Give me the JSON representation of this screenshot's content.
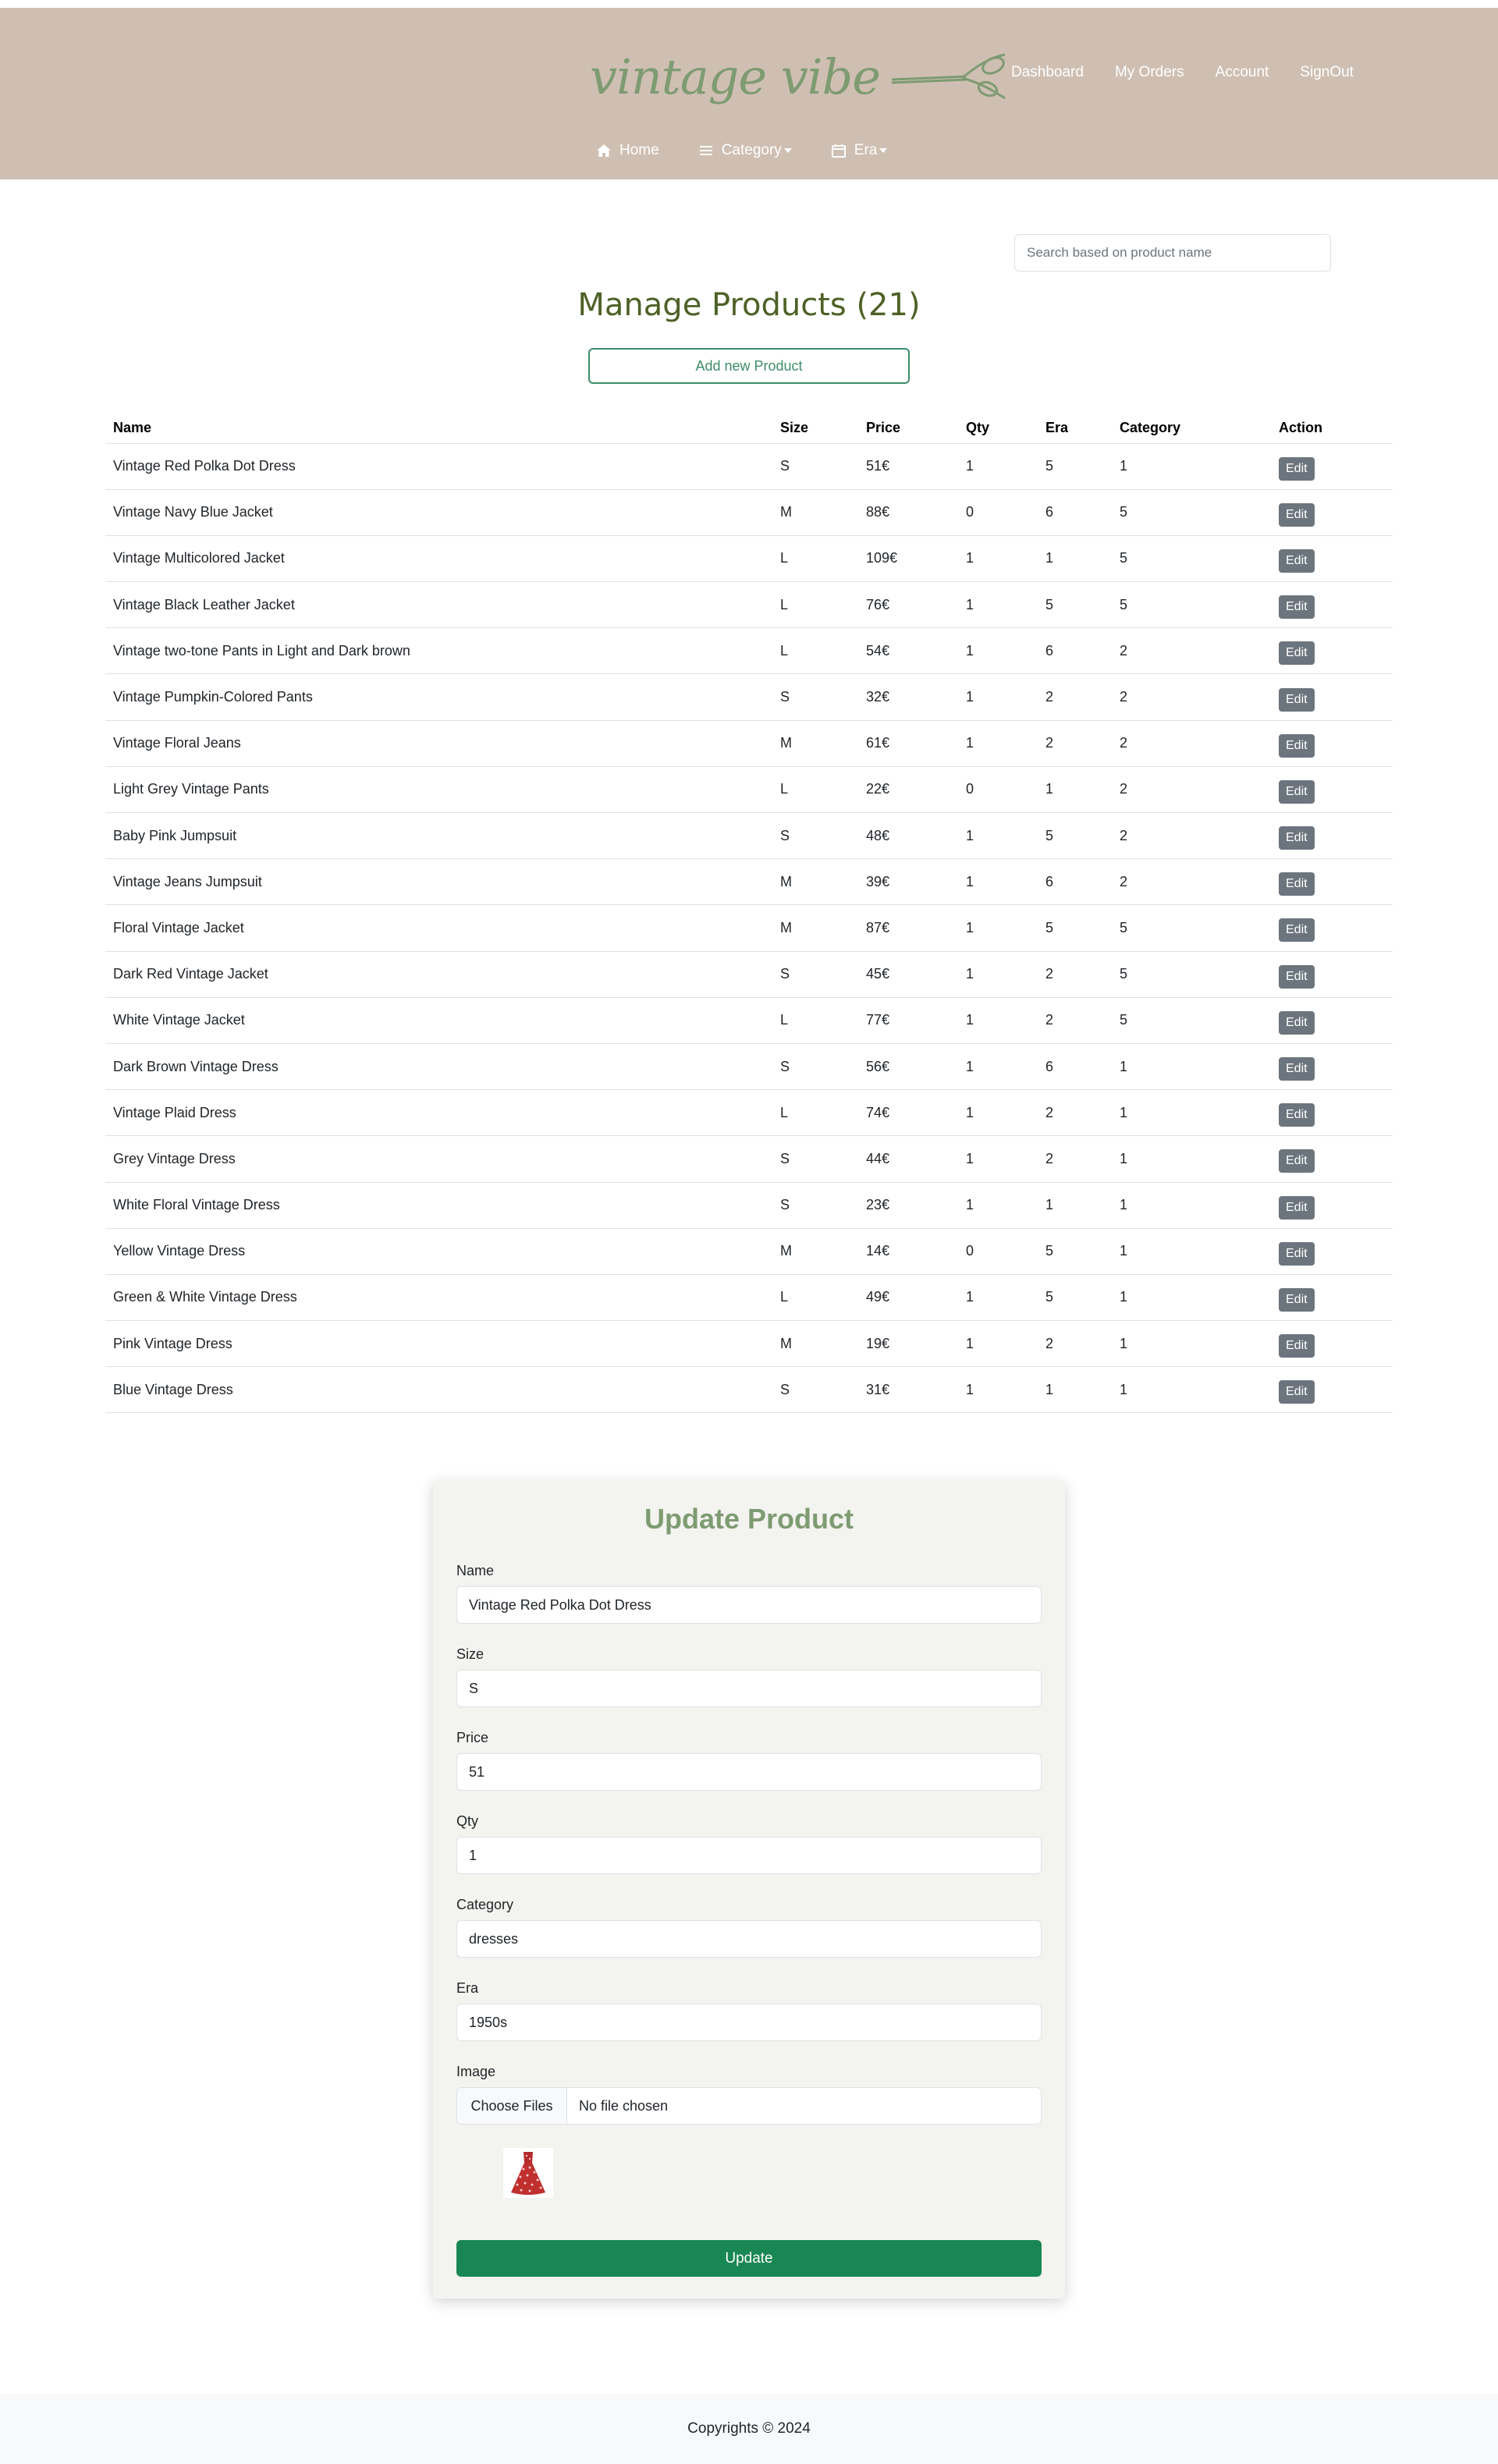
{
  "brand": {
    "name": "vintage vibe",
    "accent": "#7e9b72"
  },
  "top_links": [
    "Dashboard",
    "My Orders",
    "Account",
    "SignOut"
  ],
  "nav": {
    "home": "Home",
    "category": "Category",
    "era": "Era"
  },
  "search": {
    "placeholder": "Search based on product name"
  },
  "page": {
    "title": "Manage Products (21)",
    "add_button": "Add new Product"
  },
  "table": {
    "headers": [
      "Name",
      "Size",
      "Price",
      "Qty",
      "Era",
      "Category",
      "Action"
    ],
    "edit_label": "Edit",
    "rows": [
      [
        "Vintage Red Polka Dot Dress",
        "S",
        "51€",
        "1",
        "5",
        "1"
      ],
      [
        "Vintage Navy Blue Jacket",
        "M",
        "88€",
        "0",
        "6",
        "5"
      ],
      [
        "Vintage Multicolored Jacket",
        "L",
        "109€",
        "1",
        "1",
        "5"
      ],
      [
        "Vintage Black Leather Jacket",
        "L",
        "76€",
        "1",
        "5",
        "5"
      ],
      [
        "Vintage two-tone Pants in Light and Dark brown",
        "L",
        "54€",
        "1",
        "6",
        "2"
      ],
      [
        "Vintage Pumpkin-Colored Pants",
        "S",
        "32€",
        "1",
        "2",
        "2"
      ],
      [
        "Vintage Floral Jeans",
        "M",
        "61€",
        "1",
        "2",
        "2"
      ],
      [
        "Light Grey Vintage Pants",
        "L",
        "22€",
        "0",
        "1",
        "2"
      ],
      [
        "Baby Pink Jumpsuit",
        "S",
        "48€",
        "1",
        "5",
        "2"
      ],
      [
        "Vintage Jeans Jumpsuit",
        "M",
        "39€",
        "1",
        "6",
        "2"
      ],
      [
        "Floral Vintage Jacket",
        "M",
        "87€",
        "1",
        "5",
        "5"
      ],
      [
        "Dark Red Vintage Jacket",
        "S",
        "45€",
        "1",
        "2",
        "5"
      ],
      [
        "White Vintage Jacket",
        "L",
        "77€",
        "1",
        "2",
        "5"
      ],
      [
        "Dark Brown Vintage Dress",
        "S",
        "56€",
        "1",
        "6",
        "1"
      ],
      [
        "Vintage Plaid Dress",
        "L",
        "74€",
        "1",
        "2",
        "1"
      ],
      [
        "Grey Vintage Dress",
        "S",
        "44€",
        "1",
        "2",
        "1"
      ],
      [
        "White Floral Vintage Dress",
        "S",
        "23€",
        "1",
        "1",
        "1"
      ],
      [
        "Yellow Vintage Dress",
        "M",
        "14€",
        "0",
        "5",
        "1"
      ],
      [
        "Green & White Vintage Dress",
        "L",
        "49€",
        "1",
        "5",
        "1"
      ],
      [
        "Pink Vintage Dress",
        "M",
        "19€",
        "1",
        "2",
        "1"
      ],
      [
        "Blue Vintage Dress",
        "S",
        "31€",
        "1",
        "1",
        "1"
      ]
    ]
  },
  "form": {
    "title": "Update Product",
    "fields": [
      {
        "label": "Name",
        "value": "Vintage Red Polka Dot Dress"
      },
      {
        "label": "Size",
        "value": "S"
      },
      {
        "label": "Price",
        "value": "51"
      },
      {
        "label": "Qty",
        "value": "1"
      },
      {
        "label": "Category",
        "value": "dresses"
      },
      {
        "label": "Era",
        "value": "1950s"
      }
    ],
    "image_label": "Image",
    "file_button": "Choose Files",
    "file_status": "No file chosen",
    "submit": "Update"
  },
  "footer": {
    "text": "Copyrights © 2024"
  }
}
